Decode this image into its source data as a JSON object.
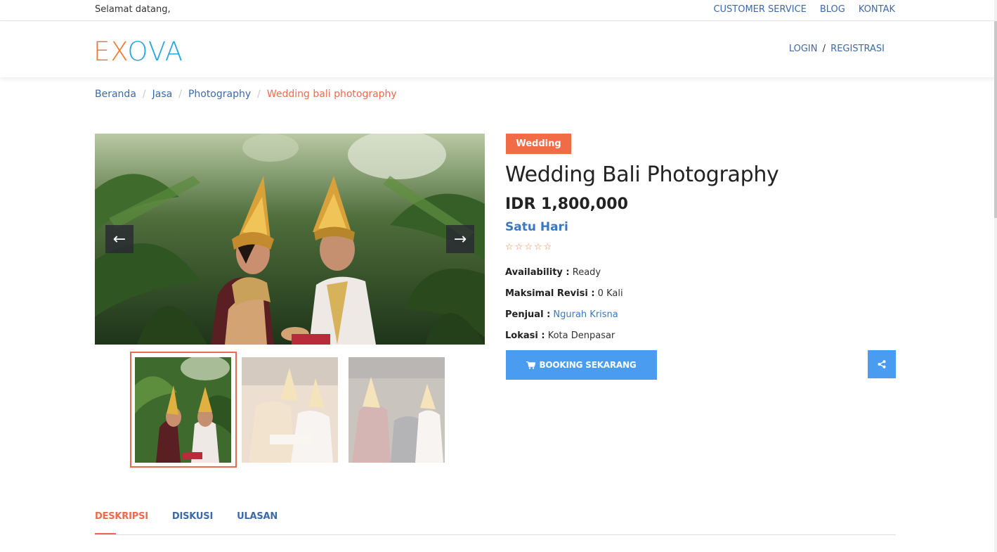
{
  "topbar": {
    "welcome": "Selamat datang,",
    "links": [
      "CUSTOMER SERVICE",
      "BLOG",
      "KONTAK"
    ]
  },
  "header": {
    "logo_part1": "EX",
    "logo_part2": "OVA",
    "login": "LOGIN",
    "separator": "/",
    "register": "REGISTRASI"
  },
  "breadcrumb": [
    "Beranda",
    "Jasa",
    "Photography",
    "Wedding bali photography"
  ],
  "gallery": {
    "prev_icon": "arrow-left-icon",
    "next_icon": "arrow-right-icon",
    "prev_glyph": "←",
    "next_glyph": "→",
    "selected_index": 0,
    "thumbnail_count": 3
  },
  "product": {
    "category": "Wedding",
    "title": "Wedding Bali Photography",
    "price": "IDR 1,800,000",
    "duration": "Satu Hari",
    "rating": 0,
    "rating_max": 5,
    "star_glyph": "☆",
    "availability_label": "Availability :",
    "availability_value": "Ready",
    "revisi_label": "Maksimal Revisi :",
    "revisi_value": "0 Kali",
    "penjual_label": "Penjual :",
    "penjual_value": "Ngurah Krisna",
    "lokasi_label": "Lokasi :",
    "lokasi_value": "Kota Denpasar"
  },
  "actions": {
    "booking_label": "BOOKING SEKARANG",
    "booking_icon": "cart-icon",
    "share_icon": "share-icon"
  },
  "tabs": [
    "DESKRIPSI",
    "DISKUSI",
    "ULASAN"
  ],
  "colors": {
    "accent_orange": "#ee6a4f",
    "badge": "#f26b47",
    "primary_blue": "#4a9cf0",
    "link_blue": "#3c6aa8",
    "logo_orange": "#f07a3a",
    "logo_blue": "#29a6e0"
  }
}
